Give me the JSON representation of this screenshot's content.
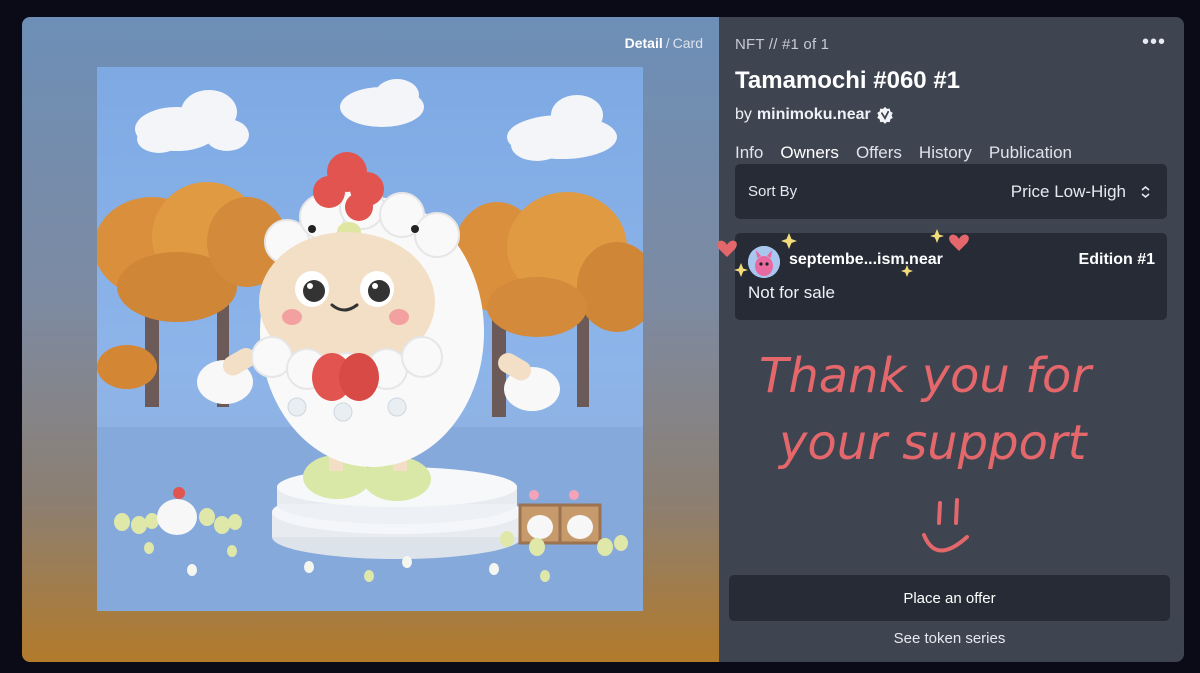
{
  "view_toggle": {
    "active": "Detail",
    "separator": "/",
    "inactive": "Card"
  },
  "artwork": {
    "subject": "3D chick-costume character on a pedestal with orange trees and clouds"
  },
  "nft": {
    "breadcrumb": "NFT // #1 of 1",
    "title": "Tamamochi #060 #1",
    "by_label": "by",
    "creator": "minimoku.near",
    "verified_icon": "verified-badge-icon",
    "more_icon": "more-dots-icon",
    "more_label": "•••"
  },
  "tabs": [
    {
      "label": "Info",
      "active": false
    },
    {
      "label": "Owners",
      "active": true
    },
    {
      "label": "Offers",
      "active": false
    },
    {
      "label": "History",
      "active": false
    },
    {
      "label": "Publication",
      "active": false
    }
  ],
  "sort": {
    "label": "Sort By",
    "value": "Price Low-High",
    "icon": "chevron-updown-icon"
  },
  "owner": {
    "name": "septembe...ism.near",
    "edition": "Edition #1",
    "status": "Not for sale"
  },
  "note": {
    "line1": "Thank you for",
    "line2": "your support",
    "face": "!! :)",
    "color": "#e3676b"
  },
  "actions": {
    "offer_label": "Place an offer",
    "series_label": "See token series"
  },
  "colors": {
    "panel": "#3e4450",
    "card": "#262b36",
    "handwriting": "#e3676b",
    "sparkle": "#f2dd7a"
  }
}
